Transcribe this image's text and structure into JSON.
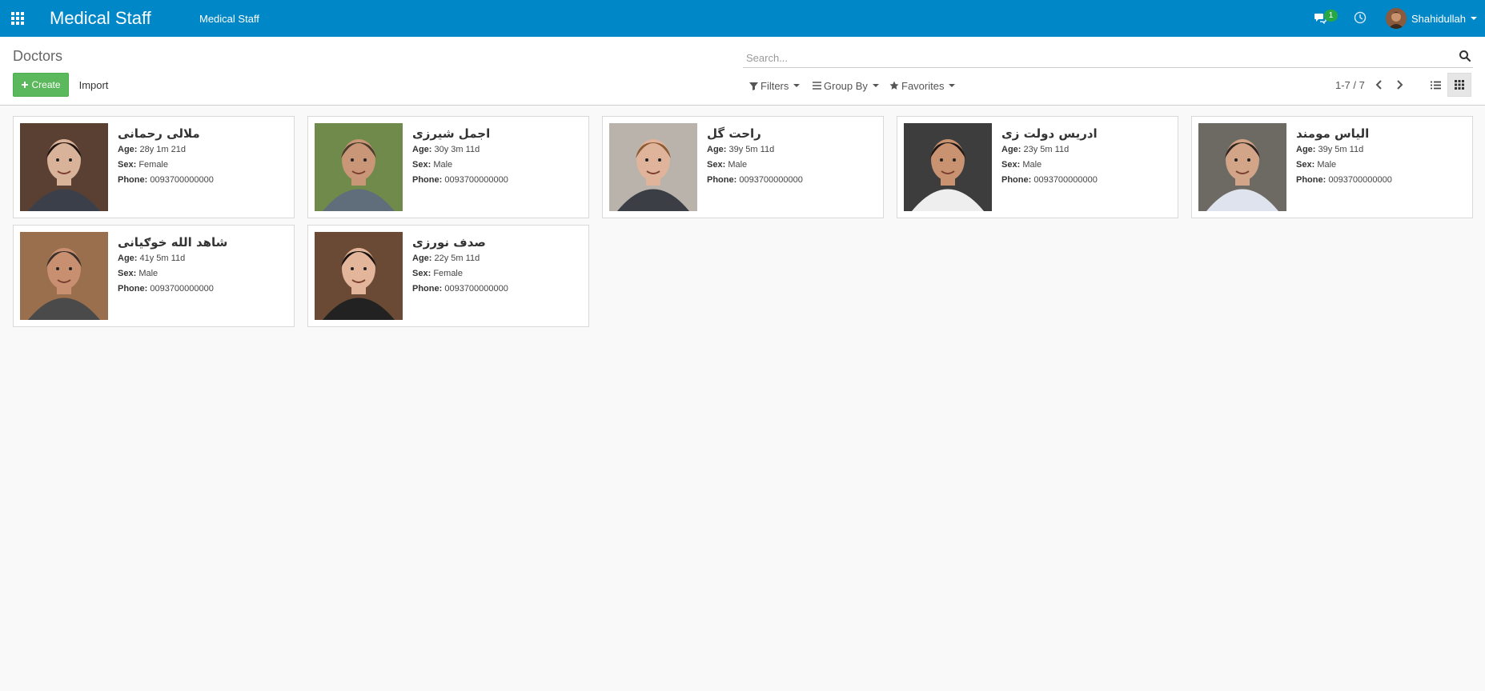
{
  "navbar": {
    "brand": "Medical Staff",
    "menu_item": "Medical Staff",
    "chat_badge": "1",
    "user_name": "Shahidullah"
  },
  "control_panel": {
    "breadcrumb": "Doctors",
    "create_label": "Create",
    "import_label": "Import",
    "search_placeholder": "Search...",
    "filters_label": "Filters",
    "groupby_label": "Group By",
    "favorites_label": "Favorites",
    "pager": "1-7 / 7"
  },
  "field_labels": {
    "age": "Age:",
    "sex": "Sex:",
    "phone": "Phone:"
  },
  "doctors": [
    {
      "name": "ملالی رحمانی",
      "age": "28y 1m 21d",
      "sex": "Female",
      "phone": "0093700000000",
      "photo": "woman-dark-hair"
    },
    {
      "name": "اجمل شیرزی",
      "age": "30y 3m 11d",
      "sex": "Male",
      "phone": "0093700000000",
      "photo": "man-outdoor-smile"
    },
    {
      "name": "راحت گل",
      "age": "39y 5m 11d",
      "sex": "Male",
      "phone": "0093700000000",
      "photo": "man-red-beard"
    },
    {
      "name": "ادریس دولت زی",
      "age": "23y 5m 11d",
      "sex": "Male",
      "phone": "0093700000000",
      "photo": "man-white-shirt"
    },
    {
      "name": "الیاس مومند",
      "age": "39y 5m 11d",
      "sex": "Male",
      "phone": "0093700000000",
      "photo": "man-collared-shirt"
    },
    {
      "name": "شاهد الله خوګیانی",
      "age": "41y 5m 11d",
      "sex": "Male",
      "phone": "0093700000000",
      "photo": "man-salute"
    },
    {
      "name": "صدف نورزی",
      "age": "22y 5m 11d",
      "sex": "Female",
      "phone": "0093700000000",
      "photo": "woman-smile"
    }
  ]
}
